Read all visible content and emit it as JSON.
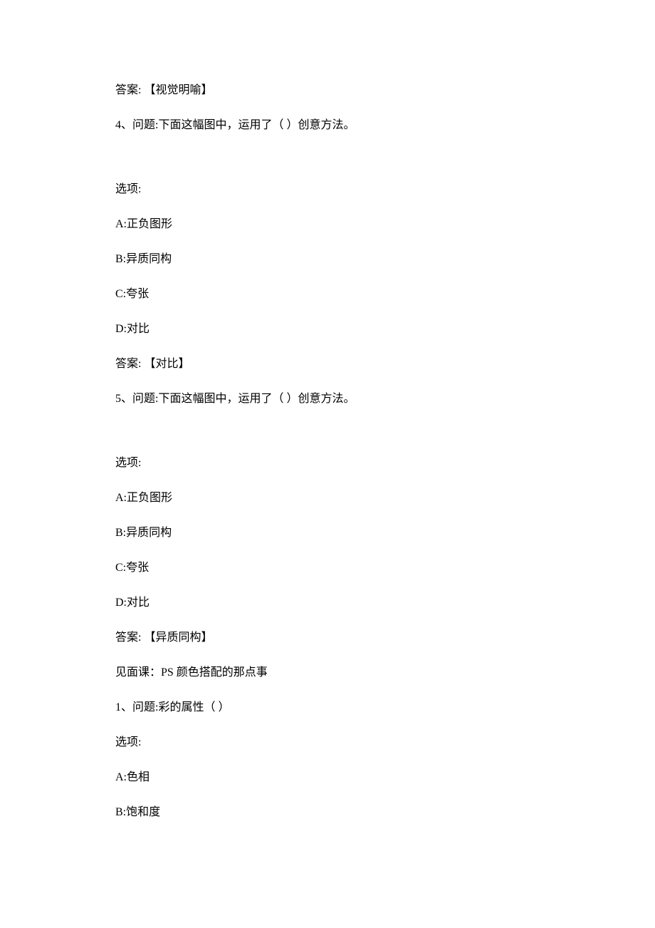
{
  "lines": [
    {
      "text": "答案: 【视觉明喻】",
      "class": "line"
    },
    {
      "text": "4、问题:下面这幅图中，运用了（ ）创意方法。",
      "class": "line-gap"
    },
    {
      "text": "选项:",
      "class": "line"
    },
    {
      "text": "A:正负图形",
      "class": "line"
    },
    {
      "text": "B:异质同构",
      "class": "line"
    },
    {
      "text": "C:夸张",
      "class": "line"
    },
    {
      "text": "D:对比",
      "class": "line"
    },
    {
      "text": "答案: 【对比】",
      "class": "line"
    },
    {
      "text": "5、问题:下面这幅图中，运用了（ ）创意方法。",
      "class": "line-gap"
    },
    {
      "text": "选项:",
      "class": "line"
    },
    {
      "text": "A:正负图形",
      "class": "line"
    },
    {
      "text": "B:异质同构",
      "class": "line"
    },
    {
      "text": "C:夸张",
      "class": "line"
    },
    {
      "text": "D:对比",
      "class": "line"
    },
    {
      "text": "答案: 【异质同构】",
      "class": "line"
    },
    {
      "text": "见面课：PS 颜色搭配的那点事",
      "class": "line"
    },
    {
      "text": "1、问题:彩的属性（  ）",
      "class": "line"
    },
    {
      "text": "选项:",
      "class": "line"
    },
    {
      "text": "A:色相",
      "class": "line"
    },
    {
      "text": "B:饱和度",
      "class": "line"
    }
  ]
}
